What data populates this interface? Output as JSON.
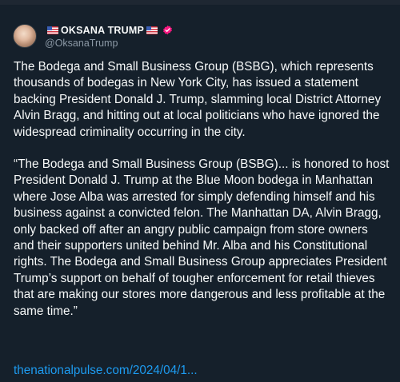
{
  "post": {
    "author": {
      "display_name": "OKSANA TRUMP",
      "handle": "@OksanaTrump",
      "flag_icon": "us-flag-icon",
      "verified_icon": "verified-badge-icon",
      "verified_color": "#f91880"
    },
    "paragraphs": [
      "The Bodega and Small Business Group (BSBG), which represents thousands of bodegas in New York City, has issued a statement backing President Donald J. Trump, slamming local District Attorney Alvin Bragg, and hitting out at local politicians who have ignored the widespread criminality occurring in the city.",
      "“The Bodega and Small Business Group (BSBG)... is honored to host President Donald J. Trump at the Blue Moon bodega in Manhattan where Jose Alba was arrested for simply defending himself and his business against a convicted felon. The Manhattan DA, Alvin Bragg, only backed off after an angry public campaign from store owners and their supporters united behind Mr. Alba and his Constitutional rights. The Bodega and Small Business Group appreciates President Trump’s support on behalf of tougher enforcement for retail thieves that are making our stores more dangerous and less profitable at the same time.”"
    ],
    "link_text": "thenationalpulse.com/2024/04/1...",
    "colors": {
      "background": "#15202b",
      "text": "#f7f9f9",
      "secondary": "#8b98a5",
      "link": "#1d9bf0"
    }
  }
}
